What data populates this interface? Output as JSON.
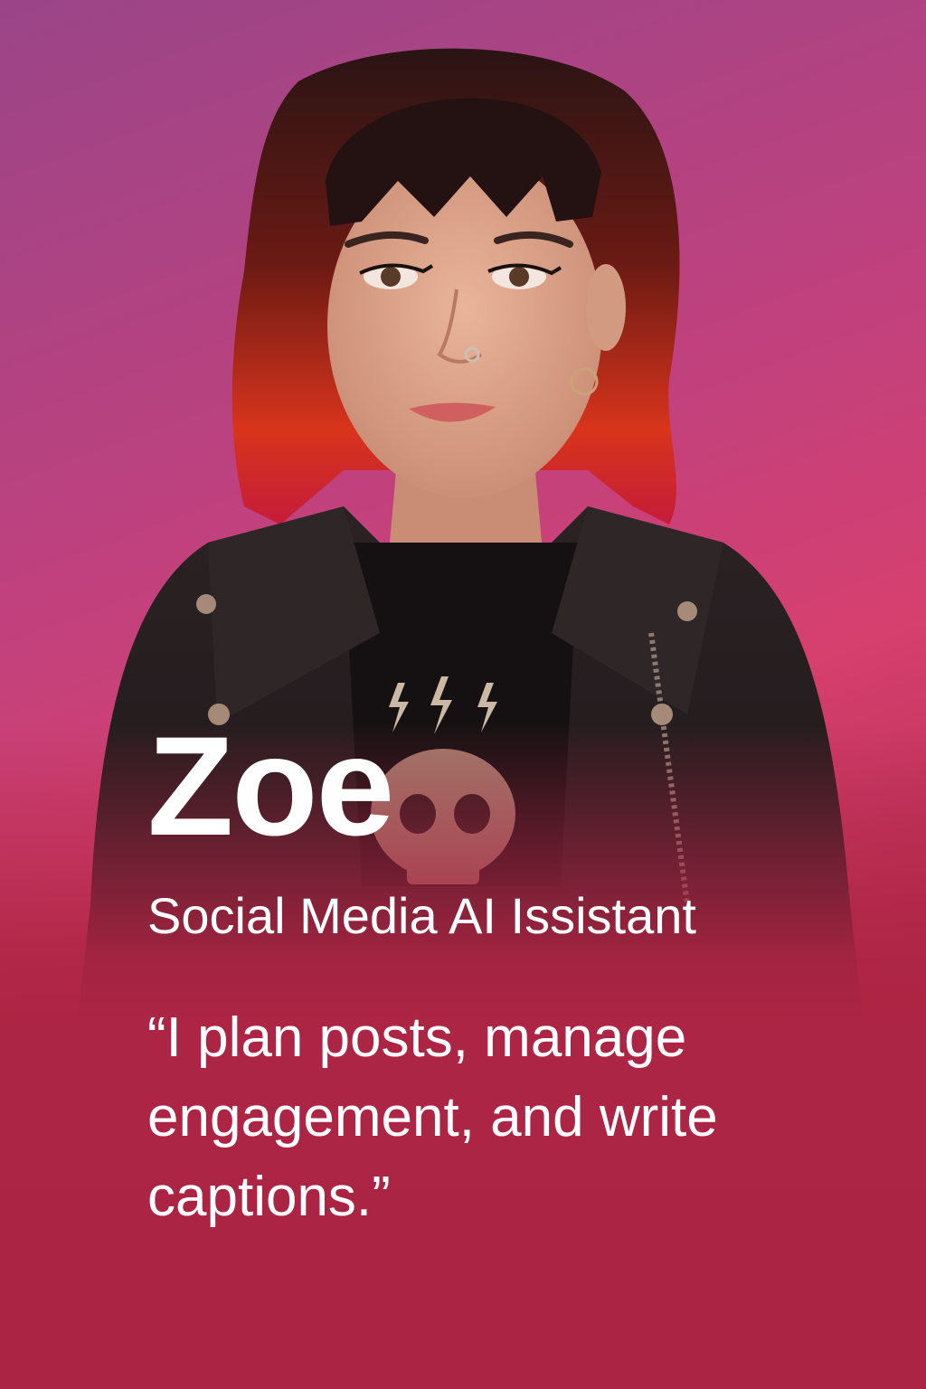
{
  "profile": {
    "name": "Zoe",
    "role": "Social Media AI Issistant",
    "quote": "“I plan posts, manage engagement, and write captions.”"
  },
  "colors": {
    "background_top": "#9a4588",
    "background_mid": "#d6406f",
    "background_bottom": "#ac2544",
    "text": "#ffffff"
  },
  "portrait": {
    "subject": "woman with red-tipped dark hair, leather jacket, skull t-shirt"
  }
}
